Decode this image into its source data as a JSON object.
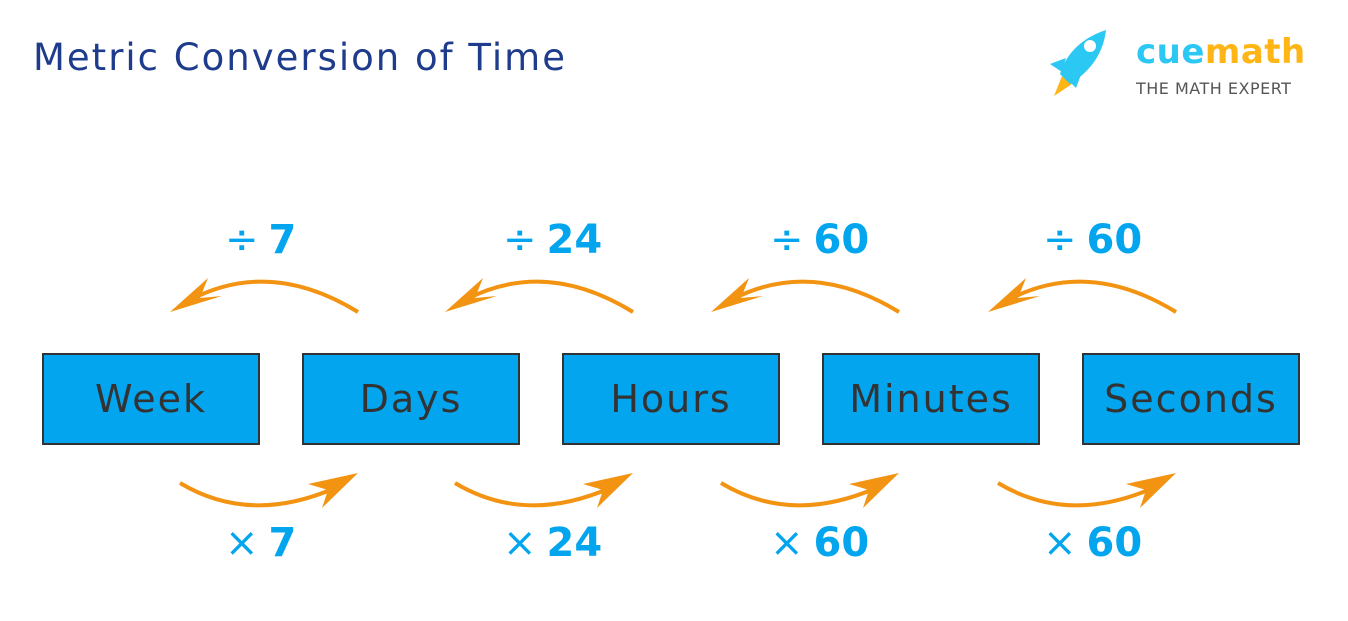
{
  "title": "Metric Conversion of Time",
  "logo": {
    "brand_part1": "cue",
    "brand_part2": "math",
    "tagline": "THE MATH EXPERT",
    "icon": "rocket-icon"
  },
  "colors": {
    "title": "#1f3c8c",
    "box_fill": "#03a6ee",
    "arrow": "#f39312",
    "operator_text": "#03a6ee",
    "box_text": "#333333"
  },
  "units": [
    "Week",
    "Days",
    "Hours",
    "Minutes",
    "Seconds"
  ],
  "divide_ops": [
    {
      "symbol": "÷",
      "value": "7"
    },
    {
      "symbol": "÷",
      "value": "24"
    },
    {
      "symbol": "÷",
      "value": "60"
    },
    {
      "symbol": "÷",
      "value": "60"
    }
  ],
  "multiply_ops": [
    {
      "symbol": "×",
      "value": "7"
    },
    {
      "symbol": "×",
      "value": "24"
    },
    {
      "symbol": "×",
      "value": "60"
    },
    {
      "symbol": "×",
      "value": "60"
    }
  ]
}
